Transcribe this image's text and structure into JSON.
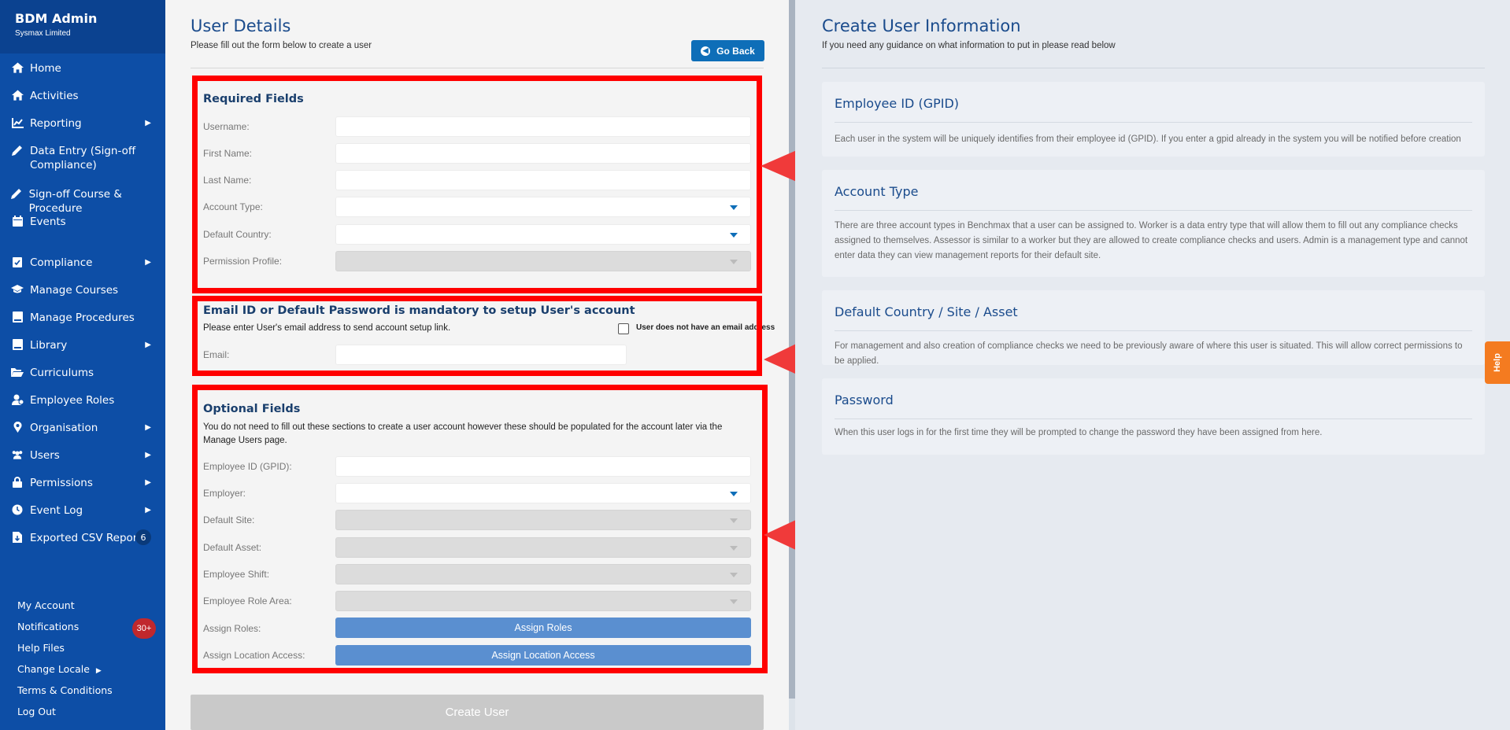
{
  "sidebar": {
    "app_name": "BDM Admin",
    "company": "Sysmax Limited",
    "items": [
      {
        "label": "Home",
        "icon": "home-icon"
      },
      {
        "label": "Activities",
        "icon": "home-icon"
      },
      {
        "label": "Reporting",
        "icon": "chart-icon"
      },
      {
        "label": "Data Entry (Sign-off",
        "label2": "Compliance)",
        "icon": "pencil-icon"
      },
      {
        "label": "Sign-off Course & Procedure",
        "icon": "pencil-icon"
      },
      {
        "label": "Events",
        "icon": "calendar-icon"
      },
      {
        "label": "Compliance",
        "icon": "clipboard-check-icon"
      },
      {
        "label": "Manage Courses",
        "icon": "graduation-cap-icon"
      },
      {
        "label": "Manage Procedures",
        "icon": "book-icon"
      },
      {
        "label": "Library",
        "icon": "book-icon"
      },
      {
        "label": "Curriculums",
        "icon": "folder-open-icon"
      },
      {
        "label": "Employee Roles",
        "icon": "user-tie-icon"
      },
      {
        "label": "Organisation",
        "icon": "map-marker-icon"
      },
      {
        "label": "Users",
        "icon": "users-icon"
      },
      {
        "label": "Permissions",
        "icon": "lock-icon"
      },
      {
        "label": "Event Log",
        "icon": "clock-icon"
      },
      {
        "label": "Exported CSV Reports",
        "icon": "file-download-icon",
        "badge": "6"
      }
    ],
    "footer": {
      "my_account": "My Account",
      "notifications": "Notifications",
      "notifications_badge": "30+",
      "help_files": "Help Files",
      "change_locale": "Change Locale",
      "terms": "Terms & Conditions",
      "log_out": "Log Out"
    }
  },
  "form": {
    "title": "User Details",
    "subtitle": "Please fill out the form below to create a user",
    "go_back": "Go Back",
    "required": {
      "title": "Required Fields",
      "username": "Username:",
      "first_name": "First Name:",
      "last_name": "Last Name:",
      "account_type": "Account Type:",
      "default_country": "Default Country:",
      "permission_profile": "Permission Profile:"
    },
    "email_section": {
      "title": "Email ID or Default Password is mandatory to setup User's account",
      "note": "Please enter User's email address to send account setup link.",
      "checkbox_label": "User does not have an email address",
      "email": "Email:"
    },
    "optional": {
      "title": "Optional Fields",
      "note": "You do not need to fill out these sections to create a user account however these should be populated for the account later via the Manage Users page.",
      "employee_id": "Employee ID (GPID):",
      "employer": "Employer:",
      "default_site": "Default Site:",
      "default_asset": "Default Asset:",
      "employee_shift": "Employee Shift:",
      "employee_role_area": "Employee Role Area:",
      "assign_roles_label": "Assign Roles:",
      "assign_roles_button": "Assign Roles",
      "assign_location_label": "Assign Location Access:",
      "assign_location_button": "Assign Location Access"
    },
    "create_user": "Create User"
  },
  "info": {
    "title": "Create User Information",
    "subtitle": "If you need any guidance on what information to put in please read below",
    "cards": [
      {
        "heading": "Employee ID (GPID)",
        "body": "Each user in the system will be uniquely identifies from their employee id (GPID). If you enter a gpid already in the system you will be notified before creation"
      },
      {
        "heading": "Account Type",
        "body": "There are three account types in Benchmax that a user can be assigned to. Worker is a data entry type that will allow them to fill out any compliance checks assigned to themselves. Assessor is similar to a worker but they are allowed to create compliance checks and users. Admin is a management type and cannot enter data they can view management reports for their default site."
      },
      {
        "heading": "Default Country / Site / Asset",
        "body": "For management and also creation of compliance checks we need to be previously aware of where this user is situated. This will allow correct permissions to be applied."
      },
      {
        "heading": "Password",
        "body": "When this user logs in for the first time they will be prompted to change the password they have been assigned from here."
      }
    ]
  },
  "help_tab": "Help",
  "colors": {
    "sidebar": "#0d4ea6",
    "accent": "#0e6eb8",
    "annotation": "#ff0000",
    "help": "#f47b20"
  }
}
